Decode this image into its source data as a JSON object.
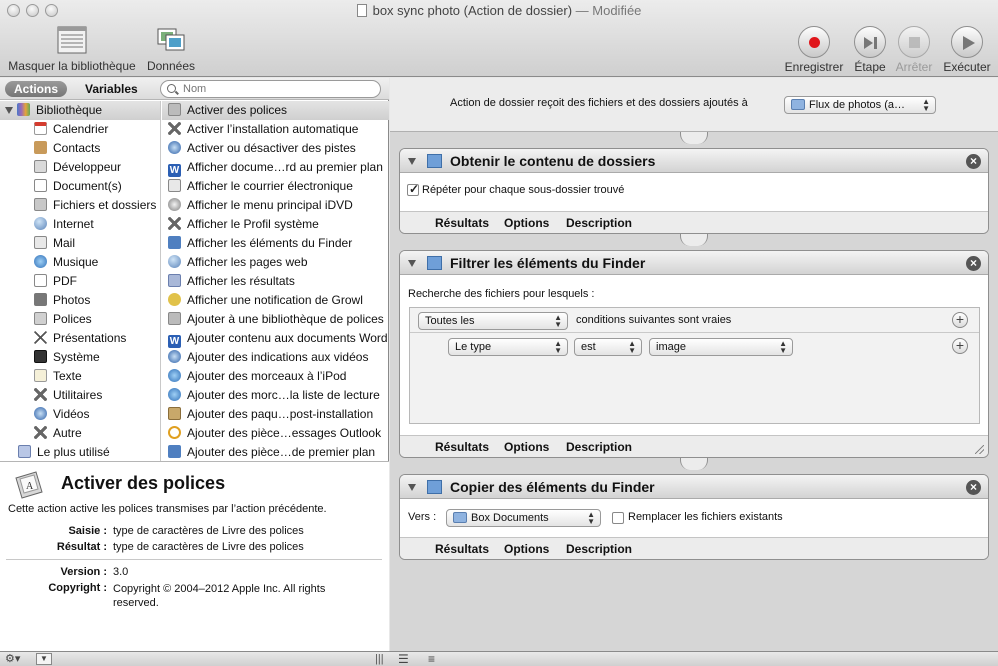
{
  "window": {
    "title": "box sync photo (Action de dossier)",
    "title_suffix": "— Modifiée"
  },
  "toolbar": {
    "hide_library": "Masquer la bibliothèque",
    "data": "Données",
    "record": "Enregistrer",
    "step": "Étape",
    "stop": "Arrêter",
    "run": "Exécuter"
  },
  "left": {
    "tabs": {
      "actions": "Actions",
      "variables": "Variables"
    },
    "search_placeholder": "Nom",
    "library": [
      {
        "label": "Bibliothèque",
        "icon": "library-icon"
      },
      {
        "label": "Calendrier",
        "icon": "calendar-icon"
      },
      {
        "label": "Contacts",
        "icon": "contacts-icon"
      },
      {
        "label": "Développeur",
        "icon": "developer-icon"
      },
      {
        "label": "Document(s)",
        "icon": "document-icon"
      },
      {
        "label": "Fichiers et dossiers",
        "icon": "folder-icon"
      },
      {
        "label": "Internet",
        "icon": "globe-icon"
      },
      {
        "label": "Mail",
        "icon": "mail-icon"
      },
      {
        "label": "Musique",
        "icon": "music-icon"
      },
      {
        "label": "PDF",
        "icon": "pdf-icon"
      },
      {
        "label": "Photos",
        "icon": "photos-icon"
      },
      {
        "label": "Polices",
        "icon": "fonts-icon"
      },
      {
        "label": "Présentations",
        "icon": "presentations-icon"
      },
      {
        "label": "Système",
        "icon": "system-icon"
      },
      {
        "label": "Texte",
        "icon": "text-icon"
      },
      {
        "label": "Utilitaires",
        "icon": "utilities-icon"
      },
      {
        "label": "Vidéos",
        "icon": "videos-icon"
      },
      {
        "label": "Autre",
        "icon": "other-icon"
      },
      {
        "label": "Le plus utilisé",
        "icon": "most-used-icon"
      }
    ],
    "actions": [
      "Activer des polices",
      "Activer l’installation automatique",
      "Activer ou désactiver des pistes",
      "Afficher docume…rd au premier plan",
      "Afficher le courrier électronique",
      "Afficher le menu principal iDVD",
      "Afficher le Profil système",
      "Afficher les éléments du Finder",
      "Afficher les pages web",
      "Afficher les résultats",
      "Afficher une notification de Growl",
      "Ajouter à une bibliothèque de polices",
      "Ajouter contenu aux documents Word",
      "Ajouter des indications aux vidéos",
      "Ajouter des morceaux à l’iPod",
      "Ajouter des morc…la liste de lecture",
      "Ajouter des paqu…post-installation",
      "Ajouter des pièce…essages Outlook",
      "Ajouter des pièce…de premier plan"
    ],
    "description": {
      "title": "Activer des polices",
      "text": "Cette action active les polices transmises par l’action précédente.",
      "input_label": "Saisie :",
      "input_value": "type de caractères de Livre des polices",
      "result_label": "Résultat :",
      "result_value": "type de caractères de Livre des polices",
      "version_label": "Version :",
      "version_value": "3.0",
      "copyright_label": "Copyright :",
      "copyright_value": "Copyright © 2004–2012 Apple Inc. All rights reserved."
    }
  },
  "workflow": {
    "receives_label": "Action de dossier reçoit des fichiers et des dossiers ajoutés à",
    "folder_value": "Flux de photos (a…",
    "action1": {
      "title": "Obtenir le contenu de dossiers",
      "checkbox_label": "Répéter pour chaque sous-dossier trouvé"
    },
    "action2": {
      "title": "Filtrer les éléments du Finder",
      "search_label": "Recherche des fichiers pour lesquels :",
      "match_value": "Toutes les",
      "conditions_label": "conditions suivantes sont vraies",
      "criterion_field": "Le type",
      "criterion_op": "est",
      "criterion_value": "image"
    },
    "action3": {
      "title": "Copier des éléments du Finder",
      "to_label": "Vers :",
      "destination": "Box Documents",
      "replace_label": "Remplacer les fichiers existants"
    },
    "tabs": {
      "results": "Résultats",
      "options": "Options",
      "description": "Description"
    }
  }
}
